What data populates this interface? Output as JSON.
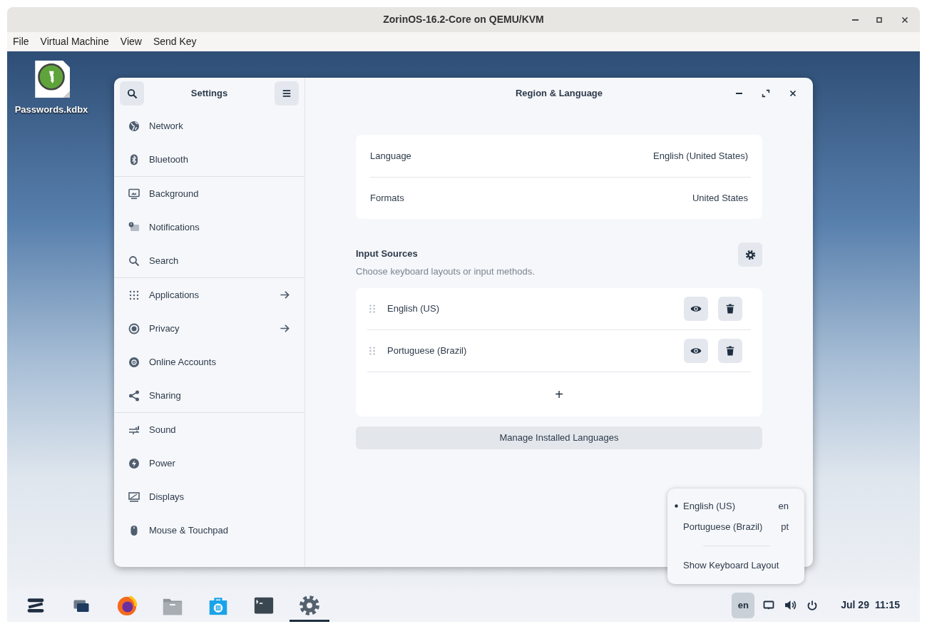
{
  "window": {
    "title": "ZorinOS-16.2-Core on QEMU/KVM"
  },
  "menu_bar": [
    "File",
    "Virtual Machine",
    "View",
    "Send Key"
  ],
  "desktop_icons": [
    {
      "label": "Passwords.kdbx"
    }
  ],
  "settings": {
    "sidebar_title": "Settings",
    "page_title": "Region & Language",
    "sidebar_groups": [
      [
        {
          "label": "Network",
          "arrow": false,
          "selected": false
        },
        {
          "label": "Bluetooth",
          "arrow": false,
          "selected": false
        }
      ],
      [
        {
          "label": "Background",
          "arrow": false,
          "selected": false
        },
        {
          "label": "Notifications",
          "arrow": false,
          "selected": false
        },
        {
          "label": "Search",
          "arrow": false,
          "selected": false
        }
      ],
      [
        {
          "label": "Applications",
          "arrow": true,
          "selected": false
        },
        {
          "label": "Privacy",
          "arrow": true,
          "selected": false
        },
        {
          "label": "Online Accounts",
          "arrow": false,
          "selected": false
        },
        {
          "label": "Sharing",
          "arrow": false,
          "selected": false
        }
      ],
      [
        {
          "label": "Sound",
          "arrow": false,
          "selected": false
        },
        {
          "label": "Power",
          "arrow": false,
          "selected": false
        },
        {
          "label": "Displays",
          "arrow": false,
          "selected": false
        },
        {
          "label": "Mouse & Touchpad",
          "arrow": false,
          "selected": false
        }
      ]
    ],
    "language_rows": [
      {
        "label": "Language",
        "value": "English (United States)"
      },
      {
        "label": "Formats",
        "value": "United States"
      }
    ],
    "input_sources": {
      "title": "Input Sources",
      "subtitle": "Choose keyboard layouts or input methods.",
      "add": "+",
      "items": [
        {
          "label": "English (US)"
        },
        {
          "label": "Portuguese (Brazil)"
        }
      ]
    },
    "manage_button": "Manage Installed Languages"
  },
  "input_menu": {
    "items": [
      {
        "label": "English (US)",
        "code": "en",
        "selected": true
      },
      {
        "label": "Portuguese (Brazil)",
        "code": "pt",
        "selected": false
      }
    ],
    "show_layout": "Show Keyboard Layout"
  },
  "taskbar": {
    "apps": [
      {
        "selected": false
      },
      {
        "selected": false
      },
      {
        "selected": false
      },
      {
        "selected": false
      },
      {
        "selected": false
      },
      {
        "selected": false
      },
      {
        "selected": true
      }
    ],
    "keyboard_indicator": "en",
    "date": "Jul 29",
    "time": "11:15"
  }
}
